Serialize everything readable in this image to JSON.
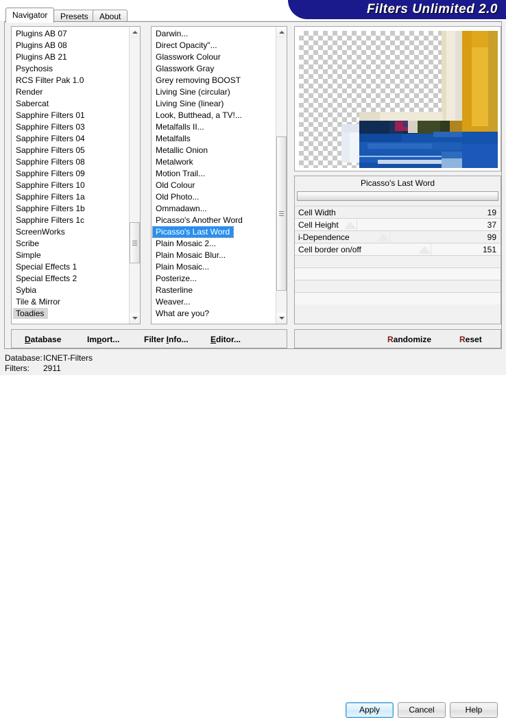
{
  "window": {
    "banner_title": "Filters Unlimited 2.0"
  },
  "tabs": [
    {
      "label": "Navigator",
      "active": true
    },
    {
      "label": "Presets",
      "active": false
    },
    {
      "label": "About",
      "active": false
    }
  ],
  "category_list": {
    "items": [
      "Plugins AB 07",
      "Plugins AB 08",
      "Plugins AB 21",
      "Psychosis",
      "RCS Filter Pak 1.0",
      "Render",
      "Sabercat",
      "Sapphire Filters 01",
      "Sapphire Filters 03",
      "Sapphire Filters 04",
      "Sapphire Filters 05",
      "Sapphire Filters 08",
      "Sapphire Filters 09",
      "Sapphire Filters 10",
      "Sapphire Filters 1a",
      "Sapphire Filters 1b",
      "Sapphire Filters 1c",
      "ScreenWorks",
      "Scribe",
      "Simple",
      "Special Effects 1",
      "Special Effects 2",
      "Sybia",
      "Tile & Mirror",
      "Toadies"
    ],
    "selected": "Toadies"
  },
  "filter_list": {
    "items": [
      "Darwin...",
      "Direct Opacity\"...",
      "Glasswork Colour",
      "Glasswork Gray",
      "Grey removing BOOST",
      "Living Sine (circular)",
      "Living Sine (linear)",
      "Look, Butthead, a TV!...",
      "Metalfalls II...",
      "Metalfalls",
      "Metallic Onion",
      "Metalwork",
      "Motion Trail...",
      "Old Colour",
      "Old Photo...",
      "Ommadawn...",
      "Picasso's Another Word",
      "Picasso's Last Word",
      "Plain Mosaic 2...",
      "Plain Mosaic Blur...",
      "Plain Mosaic...",
      "Posterize...",
      "Rasterline",
      "Weaver...",
      "What are you?"
    ],
    "selected": "Picasso's Last Word"
  },
  "params": {
    "title": "Picasso's Last Word",
    "rows": [
      {
        "name": "Cell Width",
        "value": "19",
        "marker_pct": 12
      },
      {
        "name": "Cell Height",
        "value": "37",
        "marker_pct": 24
      },
      {
        "name": "i-Dependence",
        "value": "99",
        "marker_pct": 40
      },
      {
        "name": "Cell border on/off",
        "value": "151",
        "marker_pct": 60
      },
      {
        "name": "",
        "value": "",
        "marker_pct": -1
      },
      {
        "name": "",
        "value": "",
        "marker_pct": -1
      },
      {
        "name": "",
        "value": "",
        "marker_pct": -1
      },
      {
        "name": "",
        "value": "",
        "marker_pct": -1
      }
    ]
  },
  "left_commands": [
    {
      "label": "Database",
      "accel_index": 0
    },
    {
      "label": "Import...",
      "accel_index": 2
    },
    {
      "label": "Filter Info...",
      "accel_index": 7
    },
    {
      "label": "Editor...",
      "accel_index": 0
    }
  ],
  "right_commands": [
    {
      "label": "Randomize",
      "accel_index": 0
    },
    {
      "label": "Reset",
      "accel_index": 0
    }
  ],
  "status": {
    "database_label": "Database:",
    "database_value": "ICNET-Filters",
    "filters_label": "Filters:",
    "filters_value": "2911"
  },
  "dialog_buttons": [
    {
      "label": "Apply",
      "default": true
    },
    {
      "label": "Cancel",
      "default": false
    },
    {
      "label": "Help",
      "default": false
    }
  ],
  "preview": {
    "checker_color": "#c9c9c9",
    "palette": {
      "gold": "#e0a51c",
      "gold_dark": "#c2890f",
      "gold_light": "#eebd3f",
      "cream": "#e8e2cf",
      "cream_light": "#f2eee2",
      "blue": "#1a5fc0",
      "blue_dark": "#113c7c",
      "blue_mid": "#1c55a8",
      "navy": "#0c2a52",
      "magenta": "#9e1f52",
      "olive": "#4a5226",
      "pale_blue": "#b7cde8"
    }
  }
}
